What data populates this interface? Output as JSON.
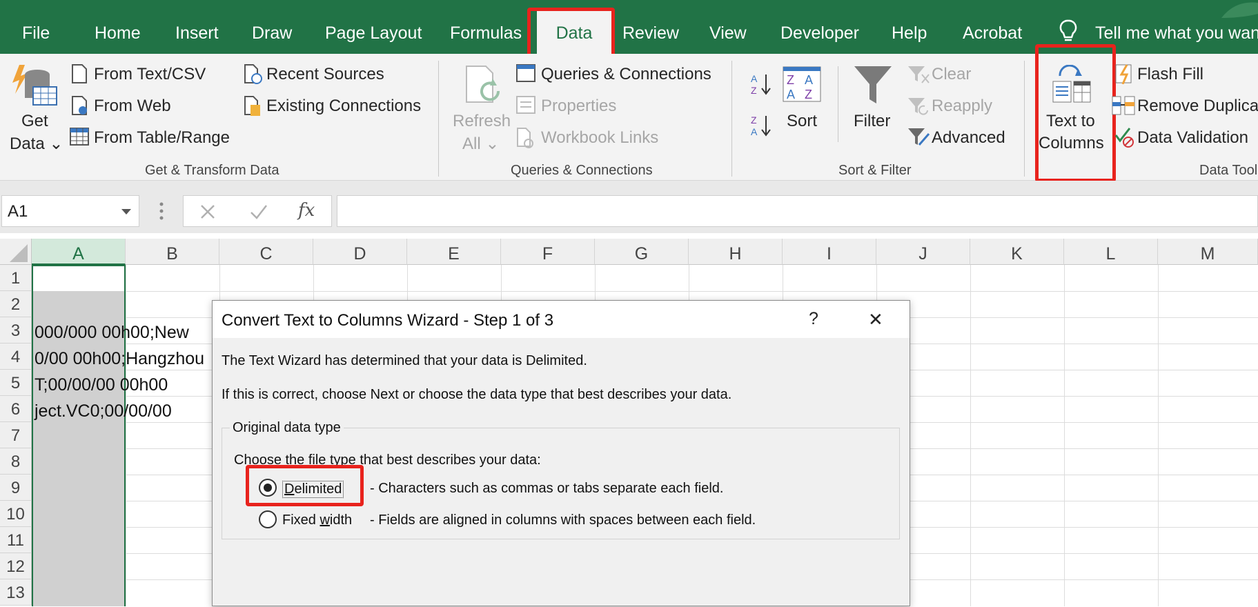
{
  "tabs": [
    "File",
    "Home",
    "Insert",
    "Draw",
    "Page Layout",
    "Formulas",
    "Data",
    "Review",
    "View",
    "Developer",
    "Help",
    "Acrobat"
  ],
  "selected_tab": "Data",
  "tell_me": "Tell me what you want",
  "ribbon": {
    "get_data": [
      "Get",
      "Data ⌄"
    ],
    "from_text_csv": "From Text/CSV",
    "from_web": "From Web",
    "from_table_range": "From Table/Range",
    "recent_sources": "Recent Sources",
    "existing_connections": "Existing Connections",
    "group_get_transform": "Get & Transform Data",
    "refresh_all": [
      "Refresh",
      "All ⌄"
    ],
    "queries_connections": "Queries & Connections",
    "properties": "Properties",
    "workbook_links": "Workbook Links",
    "group_queries": "Queries & Connections",
    "sort": "Sort",
    "filter": "Filter",
    "clear": "Clear",
    "reapply": "Reapply",
    "advanced": "Advanced",
    "group_sort_filter": "Sort & Filter",
    "text_to_columns": [
      "Text to",
      "Columns"
    ],
    "flash_fill": "Flash Fill",
    "remove_duplicates": "Remove Duplica",
    "data_validation": "Data Validation",
    "group_data_tools": "Data Tool"
  },
  "formula_bar": {
    "name_box": "A1",
    "fx": "fx",
    "value": ""
  },
  "columns": [
    "A",
    "B",
    "C",
    "D",
    "E",
    "F",
    "G",
    "H",
    "I",
    "J",
    "K",
    "L",
    "M"
  ],
  "rows": [
    "1",
    "2",
    "3",
    "4",
    "5",
    "6",
    "7",
    "8",
    "9",
    "10",
    "11",
    "12",
    "13"
  ],
  "cells": {
    "a3": "000/000 00h00;New",
    "a4": "0/00 00h00;Hangzhou",
    "a5": "T;00/00/00 00h00",
    "a6": "ject.VC0;00/00/00"
  },
  "dialog": {
    "title": "Convert Text to Columns Wizard - Step 1 of 3",
    "help": "?",
    "close": "✕",
    "line1": "The Text Wizard has determined that your data is Delimited.",
    "line2": "If this is correct, choose Next or choose the data type that best describes your data.",
    "group_label": "Original data type",
    "choose_label": "Choose the file type that best describes your data:",
    "options": [
      {
        "mnemonic": "D",
        "rest": "elimited",
        "desc": "- Characters such as commas or tabs separate each field.",
        "selected": true
      },
      {
        "pre": "Fixed ",
        "mnemonic": "w",
        "rest": "idth",
        "desc": "- Fields are aligned in columns with spaces between each field.",
        "selected": false
      }
    ]
  },
  "colors": {
    "excel_green": "#217346",
    "highlight": "#e8231d",
    "ribbon_bg": "#f3f3f3",
    "selected_col": "#d0d0d0"
  }
}
